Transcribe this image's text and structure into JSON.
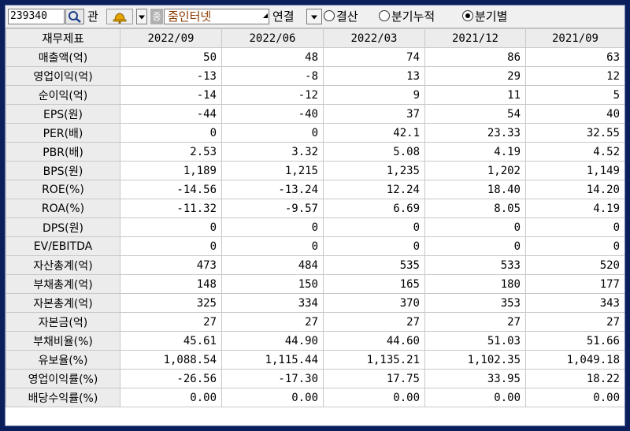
{
  "toolbar": {
    "stock_code": "239340",
    "gwan_label": "관",
    "type_badge": "종",
    "stock_name": "줌인터넷",
    "link_label": "연결",
    "radios": [
      {
        "label": "결산",
        "selected": false
      },
      {
        "label": "분기누적",
        "selected": false
      },
      {
        "label": "분기별",
        "selected": true
      }
    ]
  },
  "table": {
    "header_label": "재무제표",
    "periods": [
      "2022/09",
      "2022/06",
      "2022/03",
      "2021/12",
      "2021/09"
    ],
    "rows": [
      {
        "label": "매출액(억)",
        "values": [
          "50",
          "48",
          "74",
          "86",
          "63"
        ]
      },
      {
        "label": "영업이익(억)",
        "values": [
          "-13",
          "-8",
          "13",
          "29",
          "12"
        ]
      },
      {
        "label": "순이익(억)",
        "values": [
          "-14",
          "-12",
          "9",
          "11",
          "5"
        ]
      },
      {
        "label": "EPS(원)",
        "values": [
          "-44",
          "-40",
          "37",
          "54",
          "40"
        ]
      },
      {
        "label": "PER(배)",
        "values": [
          "0",
          "0",
          "42.1",
          "23.33",
          "32.55"
        ]
      },
      {
        "label": "PBR(배)",
        "values": [
          "2.53",
          "3.32",
          "5.08",
          "4.19",
          "4.52"
        ]
      },
      {
        "label": "BPS(원)",
        "values": [
          "1,189",
          "1,215",
          "1,235",
          "1,202",
          "1,149"
        ]
      },
      {
        "label": "ROE(%)",
        "values": [
          "-14.56",
          "-13.24",
          "12.24",
          "18.40",
          "14.20"
        ]
      },
      {
        "label": "ROA(%)",
        "values": [
          "-11.32",
          "-9.57",
          "6.69",
          "8.05",
          "4.19"
        ]
      },
      {
        "label": "DPS(원)",
        "values": [
          "0",
          "0",
          "0",
          "0",
          "0"
        ]
      },
      {
        "label": "EV/EBITDA",
        "values": [
          "0",
          "0",
          "0",
          "0",
          "0"
        ]
      },
      {
        "label": "자산총계(억)",
        "values": [
          "473",
          "484",
          "535",
          "533",
          "520"
        ]
      },
      {
        "label": "부채총계(억)",
        "values": [
          "148",
          "150",
          "165",
          "180",
          "177"
        ]
      },
      {
        "label": "자본총계(억)",
        "values": [
          "325",
          "334",
          "370",
          "353",
          "343"
        ]
      },
      {
        "label": "자본금(억)",
        "values": [
          "27",
          "27",
          "27",
          "27",
          "27"
        ]
      },
      {
        "label": "부채비율(%)",
        "values": [
          "45.61",
          "44.90",
          "44.60",
          "51.03",
          "51.66"
        ]
      },
      {
        "label": "유보율(%)",
        "values": [
          "1,088.54",
          "1,115.44",
          "1,135.21",
          "1,102.35",
          "1,049.18"
        ]
      },
      {
        "label": "영업이익률(%)",
        "values": [
          "-26.56",
          "-17.30",
          "17.75",
          "33.95",
          "18.22"
        ]
      },
      {
        "label": "배당수익률(%)",
        "values": [
          "0.00",
          "0.00",
          "0.00",
          "0.00",
          "0.00"
        ]
      }
    ]
  },
  "icons": {
    "search": "magnifier-icon",
    "alert": "bell-icon",
    "dropdown": "chevron-down-icon"
  },
  "colors": {
    "stock_name": "#8b3a00",
    "background": "#0a1f5c"
  }
}
